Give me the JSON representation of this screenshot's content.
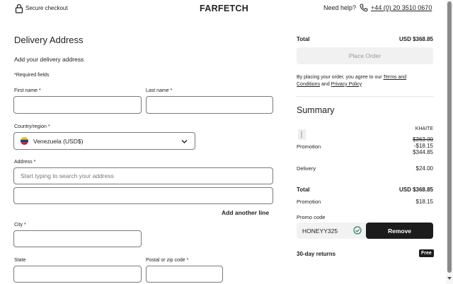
{
  "header": {
    "secure_label": "Secure checkout",
    "logo": "FARFETCH",
    "help_label": "Need help?",
    "phone": "+44 (0) 20 3510 0670"
  },
  "form": {
    "title": "Delivery Address",
    "subtitle": "Add your delivery address",
    "required_note": "*Required fields",
    "first_name_label": "First name *",
    "last_name_label": "Last name *",
    "country_label": "Country/region *",
    "country_value": "Venezuela (USD$)",
    "address_label": "Address *",
    "address_placeholder": "Start typing to search your address",
    "add_line": "Add another line",
    "city_label": "City *",
    "state_label": "State",
    "postal_label": "Postal or zip code *"
  },
  "checkout": {
    "total_label": "Total",
    "total_value": "USD $368.85",
    "place_order": "Place Order",
    "legal_prefix": "By placing your order, you agree to our",
    "terms": "Terms and Conditions",
    "legal_and": "and",
    "privacy": "Privacy Policy"
  },
  "summary": {
    "title": "Summary",
    "brand": "KHAITE",
    "original_price": "$363.00",
    "promo_label": "Promotion",
    "promo_discount": "-$18.15",
    "item_price": "$344.85",
    "delivery_label": "Delivery",
    "delivery_value": "$24.00",
    "total_label": "Total",
    "total_value": "USD $368.85",
    "promo_total_label": "Promotion",
    "promo_total_value": "$18.15",
    "promo_code_label": "Promo code",
    "promo_code_value": "HONEYY325",
    "remove_label": "Remove",
    "returns_label": "30-day returns",
    "free_badge": "Free"
  },
  "colors": {
    "accent": "#1c1c1c",
    "check": "#2e7d62",
    "flag_yellow": "#f2c200",
    "flag_blue": "#1e3c96",
    "flag_red": "#cf2027"
  }
}
